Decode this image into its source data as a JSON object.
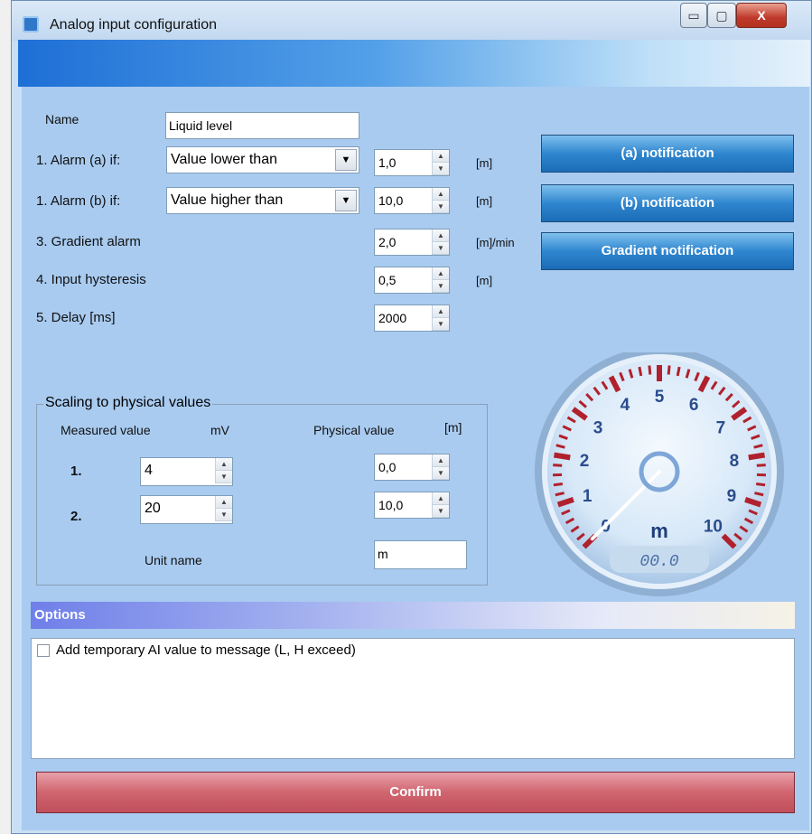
{
  "window": {
    "title": "Analog input configuration",
    "min_icon": "minimize-icon",
    "max_icon": "maximize-icon",
    "close_icon": "close-icon",
    "min_glyph": "▭",
    "max_glyph": "▢",
    "close_glyph": "X"
  },
  "form": {
    "name_label": "Name",
    "name_value": "Liquid level",
    "alarm_a_label": "1. Alarm (a) if:",
    "alarm_a_condition": "Value lower than",
    "alarm_a_value": "1,0",
    "alarm_a_unit": "[m]",
    "alarm_b_label": "1. Alarm (b) if:",
    "alarm_b_condition": "Value higher than",
    "alarm_b_value": "10,0",
    "alarm_b_unit": "[m]",
    "gradient_label": "3. Gradient alarm",
    "gradient_value": "2,0",
    "gradient_unit": "[m]/min",
    "hysteresis_label": "4. Input hysteresis",
    "hysteresis_value": "0,5",
    "hysteresis_unit": "[m]",
    "delay_label": "5. Delay [ms]",
    "delay_value": "2000"
  },
  "notifications": {
    "a": "(a) notification",
    "b": "(b) notification",
    "gradient": "Gradient notification"
  },
  "scaling": {
    "title": "Scaling to physical values",
    "measured_header": "Measured value",
    "measured_unit": "mV",
    "physical_header": "Physical value",
    "physical_unit": "[m]",
    "rows": [
      {
        "index": "1.",
        "measured": "4",
        "physical": "0,0"
      },
      {
        "index": "2.",
        "measured": "20",
        "physical": "10,0"
      }
    ],
    "unit_name_label": "Unit name",
    "unit_name_value": "m"
  },
  "gauge": {
    "unit": "m",
    "readout": "00.0",
    "min": 0,
    "max": 10,
    "value": 0,
    "ticks": [
      "0",
      "1",
      "2",
      "3",
      "4",
      "5",
      "6",
      "7",
      "8",
      "9",
      "10"
    ]
  },
  "options": {
    "title": "Options",
    "checkbox_label": "Add temporary AI value to message (L, H exceed)",
    "checked": false
  },
  "confirm_label": "Confirm",
  "spin_up": "▲",
  "spin_down": "▼",
  "dropdown_glyph": "▼"
}
